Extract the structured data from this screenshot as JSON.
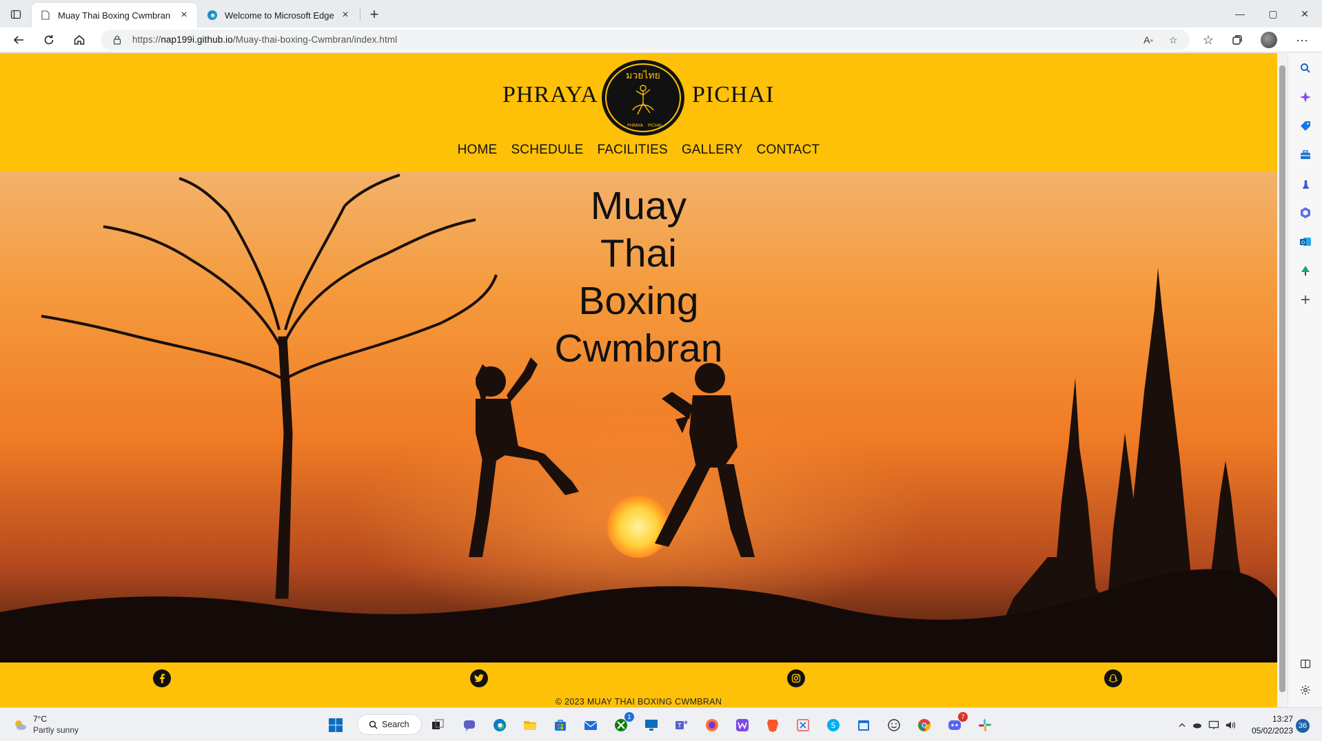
{
  "browser": {
    "tabs": [
      {
        "title": "Muay Thai Boxing Cwmbran",
        "active": true
      },
      {
        "title": "Welcome to Microsoft Edge",
        "active": false
      }
    ],
    "url_prefix": "https://",
    "url_host": "nap199i.github.io",
    "url_path": "/Muay-thai-boxing-Cwmbran/index.html"
  },
  "site": {
    "brand_left": "PHRAYA",
    "brand_right": "PICHAI",
    "logo_text_top": "มวยไทย",
    "logo_text_left": "PHRAYA",
    "logo_text_right": "PICHAI",
    "nav": [
      "HOME",
      "SCHEDULE",
      "FACILITIES",
      "GALLERY",
      "CONTACT"
    ],
    "hero_lines": [
      "Muay",
      "Thai",
      "Boxing",
      "Cwmbran"
    ],
    "social": [
      "facebook-icon",
      "twitter-icon",
      "instagram-icon",
      "snapchat-icon"
    ],
    "copyright": "© 2023 MUAY THAI BOXING CWMBRAN"
  },
  "taskbar": {
    "weather_temp": "7°C",
    "weather_desc": "Partly sunny",
    "search_label": "Search",
    "time": "13:27",
    "date": "05/02/2023",
    "notifications": "36",
    "badges": {
      "teams": "1",
      "discord": "7"
    }
  },
  "colors": {
    "accent": "#FFC107",
    "text": "#111111"
  }
}
